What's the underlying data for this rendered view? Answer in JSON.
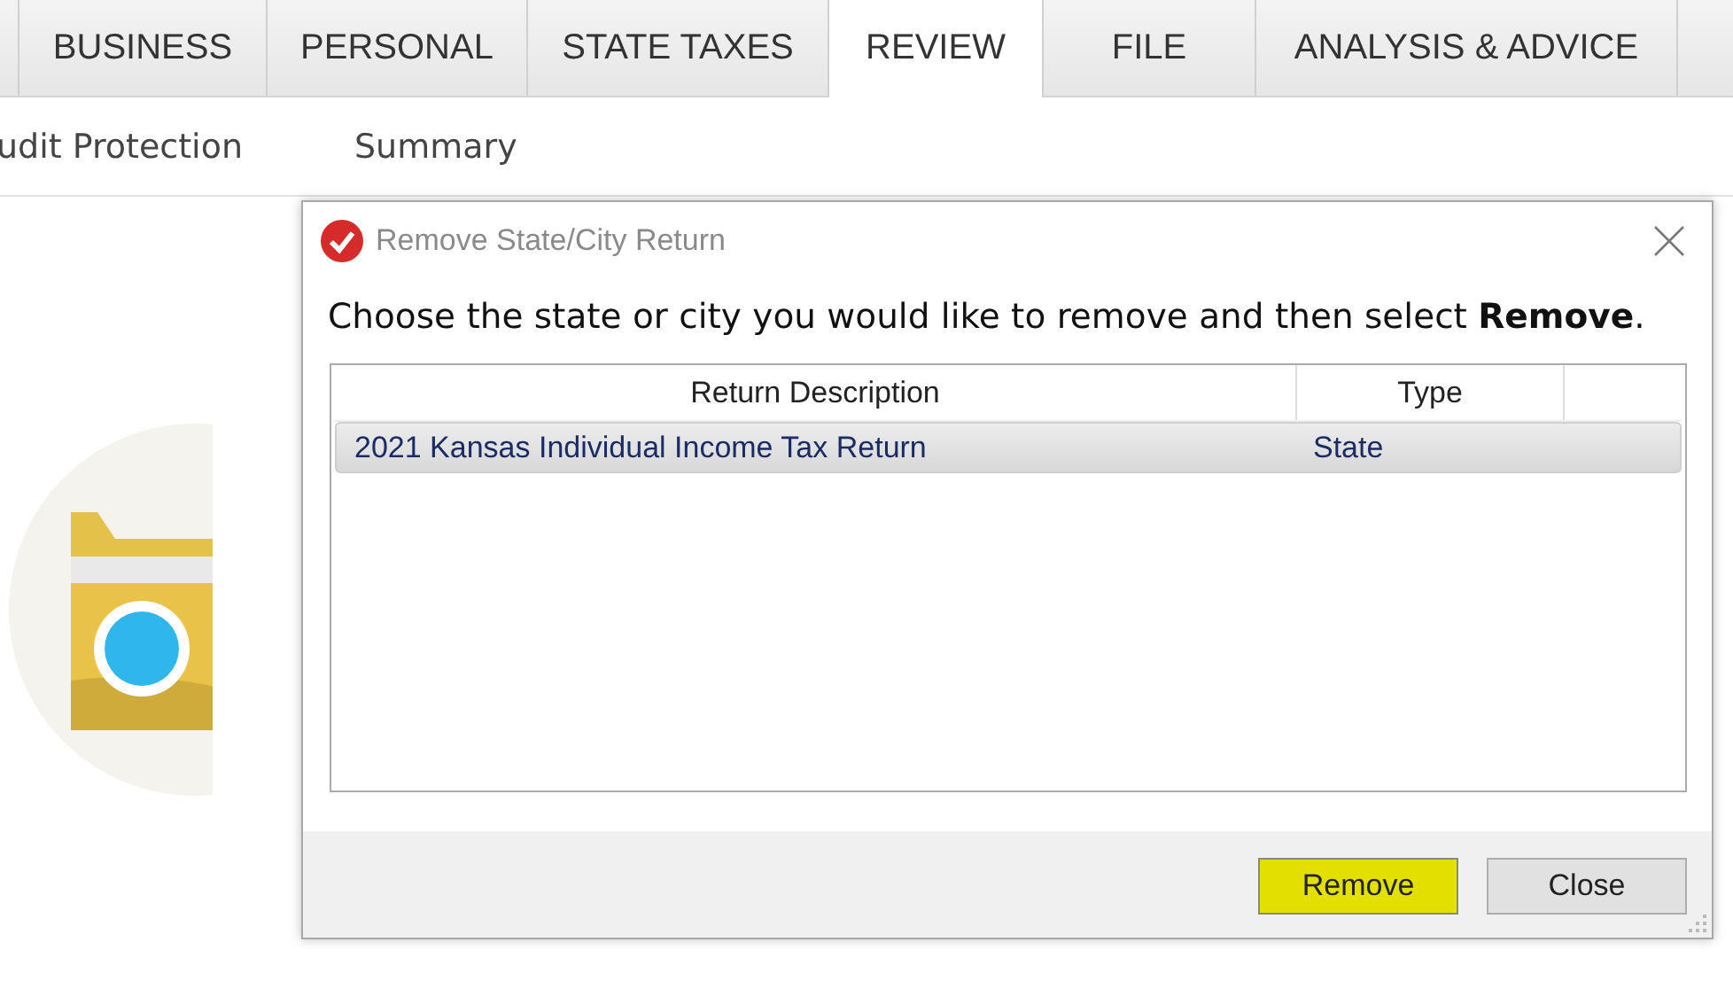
{
  "tabs": [
    {
      "label": "BUSINESS",
      "selected": false
    },
    {
      "label": "PERSONAL",
      "selected": false
    },
    {
      "label": "STATE TAXES",
      "selected": false
    },
    {
      "label": "REVIEW",
      "selected": true
    },
    {
      "label": "FILE",
      "selected": false
    },
    {
      "label": "ANALYSIS & ADVICE",
      "selected": false
    }
  ],
  "subnav": [
    {
      "label": "udit Protection"
    },
    {
      "label": "Summary"
    }
  ],
  "dialog": {
    "title": "Remove State/City Return",
    "instruction": "Choose the state or city you would like to remove and then select **Remove**.",
    "table": {
      "columns": [
        "Return Description",
        "Type"
      ],
      "rows": [
        {
          "description": "2021 Kansas Individual Income Tax Return",
          "type": "State",
          "selected": true
        }
      ]
    },
    "buttons": [
      {
        "label": "Remove",
        "highlighted": true
      },
      {
        "label": "Close",
        "highlighted": false
      }
    ]
  }
}
